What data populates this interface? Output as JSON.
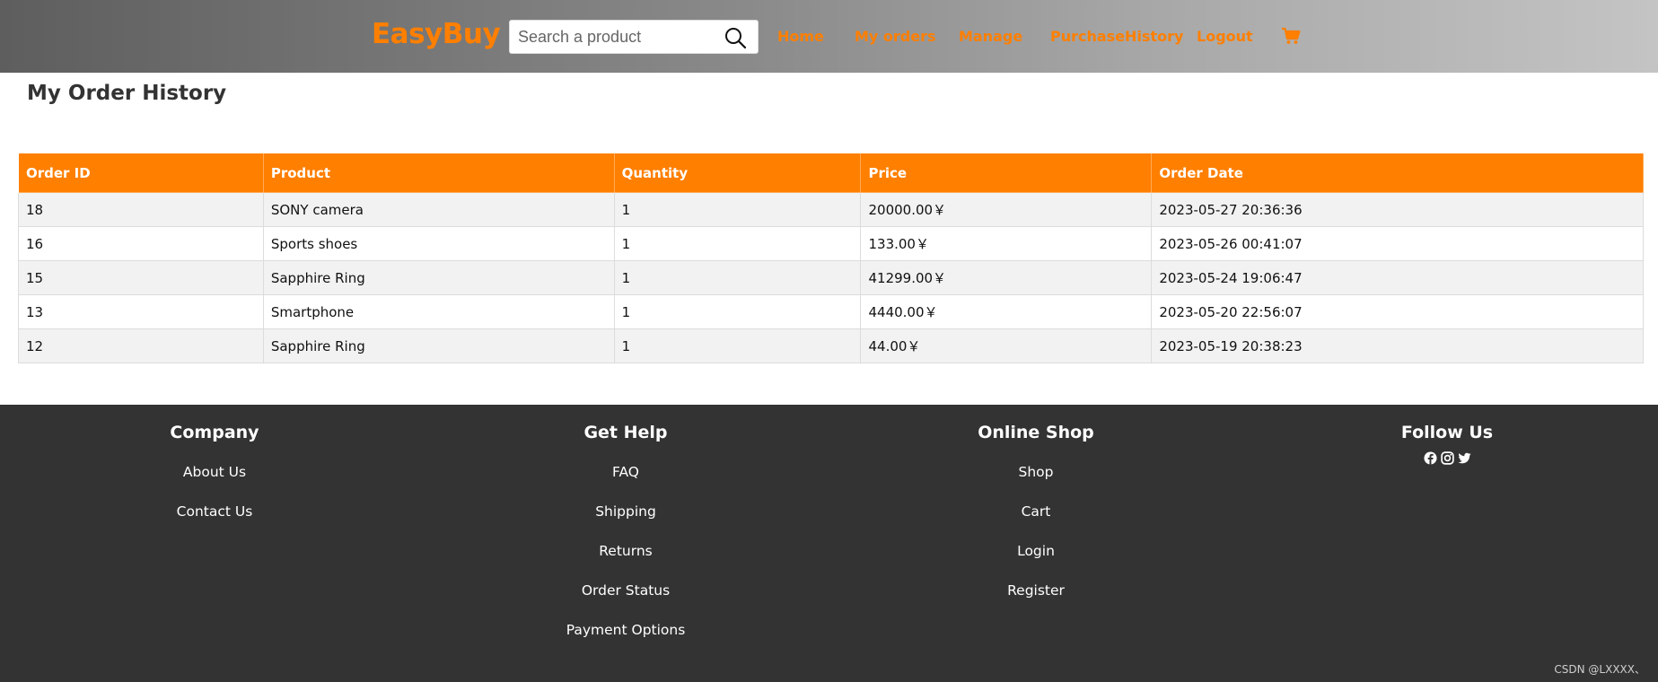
{
  "header": {
    "brand": "EasyBuy",
    "search_placeholder": "Search a product",
    "nav": [
      {
        "label": "Home"
      },
      {
        "label": "My orders"
      },
      {
        "label": "Manage"
      },
      {
        "label": "PurchaseHistory"
      },
      {
        "label": "Logout"
      }
    ],
    "cart_icon": "shopping-cart-icon",
    "search_icon": "search-icon"
  },
  "main": {
    "title": "My Order History",
    "table": {
      "columns": [
        "Order ID",
        "Product",
        "Quantity",
        "Price",
        "Order Date"
      ],
      "rows": [
        [
          "18",
          "SONY camera",
          "1",
          "20000.00￥",
          "2023-05-27 20:36:36"
        ],
        [
          "16",
          "Sports shoes",
          "1",
          "133.00￥",
          "2023-05-26 00:41:07"
        ],
        [
          "15",
          "Sapphire Ring",
          "1",
          "41299.00￥",
          "2023-05-24 19:06:47"
        ],
        [
          "13",
          "Smartphone",
          "1",
          "4440.00￥",
          "2023-05-20 22:56:07"
        ],
        [
          "12",
          "Sapphire Ring",
          "1",
          "44.00￥",
          "2023-05-19 20:38:23"
        ]
      ]
    }
  },
  "footer": {
    "columns": [
      {
        "title": "Company",
        "links": [
          "About Us",
          "Contact Us"
        ]
      },
      {
        "title": "Get Help",
        "links": [
          "FAQ",
          "Shipping",
          "Returns",
          "Order Status",
          "Payment Options"
        ]
      },
      {
        "title": "Online Shop",
        "links": [
          "Shop",
          "Cart",
          "Login",
          "Register"
        ]
      },
      {
        "title": "Follow Us",
        "links": []
      }
    ],
    "social_icons": [
      "facebook-icon",
      "instagram-icon",
      "twitter-icon"
    ],
    "credit": "CSDN @LXXXX、"
  },
  "colors": {
    "accent": "#ff7f00",
    "footer_bg": "#333333",
    "row_alt": "#f2f2f2"
  }
}
